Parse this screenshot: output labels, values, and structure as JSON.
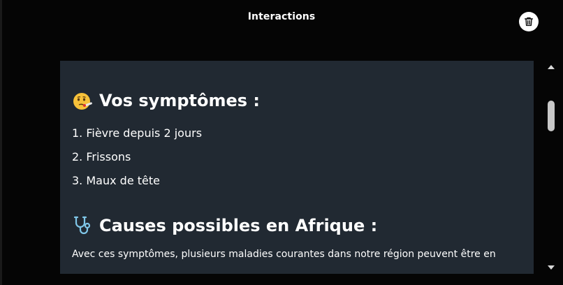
{
  "header": {
    "title": "Interactions",
    "delete_icon": "trash-icon"
  },
  "content": {
    "symptoms_section": {
      "emoji": "face-with-thermometer-icon",
      "heading": "Vos symptômes :",
      "items": [
        "1. Fièvre depuis 2 jours",
        "2. Frissons",
        "3. Maux de tête"
      ]
    },
    "causes_section": {
      "emoji": "stethoscope-icon",
      "heading": "Causes possibles en Afrique :",
      "paragraph": "Avec ces symptômes, plusieurs maladies courantes dans notre région peuvent être en"
    }
  },
  "scrollbar": {
    "up_icon": "arrow-up-icon",
    "down_icon": "arrow-down-icon"
  }
}
